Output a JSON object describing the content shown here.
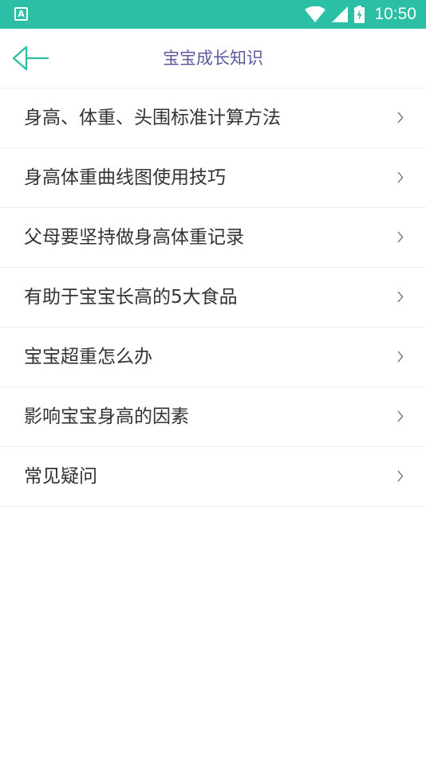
{
  "status_bar": {
    "notification_icon": "A",
    "icons": [
      "wifi-icon",
      "signal-icon",
      "battery-icon"
    ],
    "time": "10:50",
    "background_color": "#2bbfa6"
  },
  "header": {
    "back_icon": "back-arrow-icon",
    "title": "宝宝成长知识",
    "title_color": "#5b5b9e",
    "accent_color": "#2bbfa6"
  },
  "items": [
    {
      "label": "身高、体重、头围标准计算方法"
    },
    {
      "label": "身高体重曲线图使用技巧"
    },
    {
      "label": "父母要坚持做身高体重记录"
    },
    {
      "label": "有助于宝宝长高的5大食品"
    },
    {
      "label": "宝宝超重怎么办"
    },
    {
      "label": "影响宝宝身高的因素"
    },
    {
      "label": "常见疑问"
    }
  ]
}
